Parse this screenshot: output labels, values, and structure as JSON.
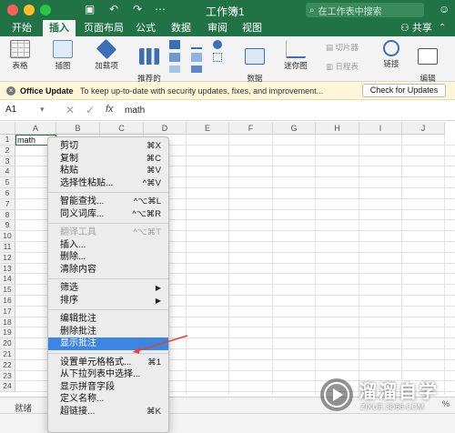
{
  "titlebar": {
    "title": "工作簿1",
    "search_placeholder": "在工作表中搜索",
    "quick_icons": [
      "save-icon",
      "undo-icon",
      "redo-icon",
      "more-icon"
    ]
  },
  "tabs": [
    {
      "label": "开始",
      "active": false
    },
    {
      "label": "插入",
      "active": true
    },
    {
      "label": "页面布局",
      "active": false
    },
    {
      "label": "公式",
      "active": false
    },
    {
      "label": "数据",
      "active": false
    },
    {
      "label": "审阅",
      "active": false
    },
    {
      "label": "视图",
      "active": false
    }
  ],
  "share_label": "共享",
  "ribbon": {
    "buttons": [
      {
        "label": "表格"
      },
      {
        "label": "插图"
      },
      {
        "label": "加载项"
      },
      {
        "label": "推荐的\n图表"
      },
      {
        "label": "数据\n透视图"
      },
      {
        "label": "迷你图"
      },
      {
        "label": "切片器"
      },
      {
        "label": "日程表"
      },
      {
        "label": "链接"
      },
      {
        "label": "编辑\n批注"
      }
    ]
  },
  "update_bar": {
    "title": "Office Update",
    "message": "To keep up-to-date with security updates, fixes, and improvement...",
    "button": "Check for Updates"
  },
  "formula_bar": {
    "name_box": "A1",
    "fx": "fx",
    "value": "math"
  },
  "grid": {
    "columns": [
      "A",
      "B",
      "C",
      "D",
      "E",
      "F",
      "G",
      "H",
      "I",
      "J"
    ],
    "rows": [
      "1",
      "2",
      "3",
      "4",
      "5",
      "6",
      "7",
      "8",
      "9",
      "10",
      "11",
      "12",
      "13",
      "14",
      "15",
      "16",
      "17",
      "18",
      "19",
      "20",
      "21",
      "22",
      "23",
      "24"
    ],
    "cell_A1": "math"
  },
  "status": {
    "ready": "就绪",
    "zoom_fragment": "%"
  },
  "context_menu": {
    "groups": [
      [
        {
          "label": "剪切",
          "shortcut": "⌘X"
        },
        {
          "label": "复制",
          "shortcut": "⌘C"
        },
        {
          "label": "粘贴",
          "shortcut": "⌘V"
        },
        {
          "label": "选择性粘贴...",
          "shortcut": "^⌘V"
        }
      ],
      [
        {
          "label": "智能查找...",
          "shortcut": "^⌥⌘L"
        },
        {
          "label": "同义词库...",
          "shortcut": "^⌥⌘R"
        }
      ],
      [
        {
          "label": "翻译工具",
          "shortcut": "^⌥⌘T",
          "disabled": true
        },
        {
          "label": "插入..."
        },
        {
          "label": "删除..."
        },
        {
          "label": "清除内容"
        }
      ],
      [
        {
          "label": "筛选",
          "shortcut": "▶"
        },
        {
          "label": "排序",
          "shortcut": "▶"
        }
      ],
      [
        {
          "label": "编辑批注"
        },
        {
          "label": "删除批注"
        },
        {
          "label": "显示批注",
          "highlighted": true
        }
      ],
      [
        {
          "label": "设置单元格格式...",
          "shortcut": "⌘1"
        },
        {
          "label": "从下拉列表中选择..."
        },
        {
          "label": "显示拼音字段"
        },
        {
          "label": "定义名称..."
        },
        {
          "label": "超链接...",
          "shortcut": "⌘K"
        }
      ]
    ]
  },
  "watermark": {
    "title": "溜溜自学",
    "subtitle": "ZIXUE.3D66.COM"
  },
  "colors": {
    "excel_green": "#217346",
    "menu_highlight": "#3b86e5",
    "arrow": "#e8442e"
  }
}
